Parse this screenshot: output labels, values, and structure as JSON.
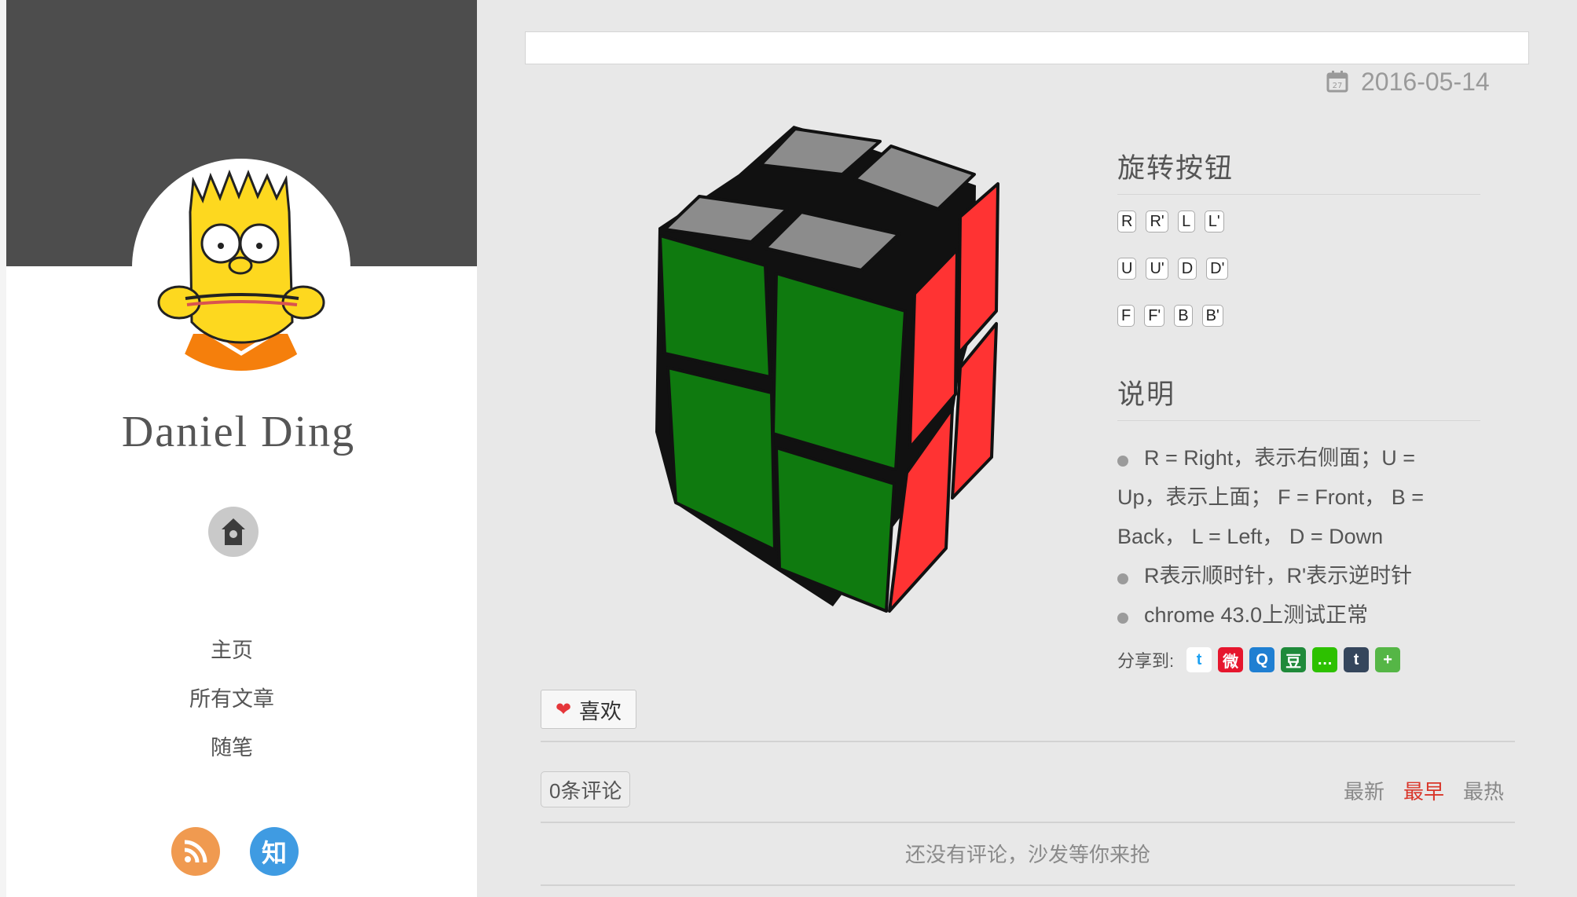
{
  "sidebar": {
    "author": "Daniel Ding",
    "nav": [
      {
        "label": "主页"
      },
      {
        "label": "所有文章"
      },
      {
        "label": "随笔"
      }
    ],
    "social": {
      "zhihu": "知"
    }
  },
  "post": {
    "title": "",
    "date": "2016-05-14",
    "calendar_day": "27"
  },
  "cube": {
    "colors": {
      "top": "#8c8c8c",
      "front": "#0f7a0f",
      "right": "#ff3333",
      "edge": "#111111"
    }
  },
  "panel": {
    "rotate_heading": "旋转按钮",
    "buttons": [
      [
        "R",
        "R'",
        "L",
        "L'"
      ],
      [
        "U",
        "U'",
        "D",
        "D'"
      ],
      [
        "F",
        "F'",
        "B",
        "B'"
      ]
    ],
    "notes_heading": "说明",
    "notes": [
      "R = Right，表示右侧面；U = Up，表示上面；  F = Front，  B = Back，  L = Left，  D = Down",
      "R表示顺时针，R'表示逆时针",
      "chrome 43.0上测试正常"
    ]
  },
  "share": {
    "label": "分享到:",
    "icons": [
      {
        "name": "twitter-icon",
        "color": "#ffffff",
        "glyph": "t"
      },
      {
        "name": "weibo-icon",
        "color": "#e6162d",
        "glyph": "微"
      },
      {
        "name": "qq-icon",
        "color": "#1f7fd2",
        "glyph": "Q"
      },
      {
        "name": "douban-icon",
        "color": "#1f8a3a",
        "glyph": "豆"
      },
      {
        "name": "wechat-icon",
        "color": "#2dc100",
        "glyph": "…"
      },
      {
        "name": "tumblr-icon",
        "color": "#35465c",
        "glyph": "t"
      },
      {
        "name": "more-share-icon",
        "color": "#55b646",
        "glyph": "+"
      }
    ]
  },
  "like": {
    "label": "喜欢"
  },
  "comments": {
    "count_label": "0条评论",
    "sort": [
      {
        "label": "最新",
        "active": false
      },
      {
        "label": "最早",
        "active": true
      },
      {
        "label": "最热",
        "active": false
      }
    ],
    "empty_text": "还没有评论，沙发等你来抢"
  }
}
